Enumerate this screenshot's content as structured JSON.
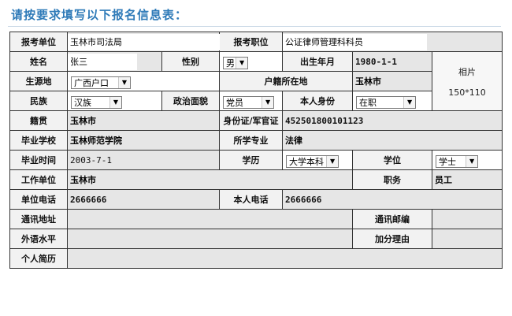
{
  "page": {
    "title": "请按要求填写以下报名信息表："
  },
  "form": {
    "bkdw": {
      "label": "报考单位",
      "value": "玉林市司法局"
    },
    "bkzw": {
      "label": "报考职位",
      "value": "公证律师管理科科员"
    },
    "name": {
      "label": "姓名",
      "value": "张三"
    },
    "gender": {
      "label": "性别",
      "value": "男"
    },
    "birth": {
      "label": "出生年月",
      "value": "1980-1-1"
    },
    "photo": {
      "line1": "相片",
      "line2": "150*110"
    },
    "origin": {
      "label": "生源地",
      "value": "广西户口"
    },
    "hukou": {
      "label": "户籍所在地",
      "value": "玉林市"
    },
    "ethnic": {
      "label": "民族",
      "value": "汉族"
    },
    "politic": {
      "label": "政治面貌",
      "value": "党员"
    },
    "identity": {
      "label": "本人身份",
      "value": "在职"
    },
    "native": {
      "label": "籍贯",
      "value": "玉林市"
    },
    "idcard": {
      "label": "身份证/军官证",
      "value": "452501800101123"
    },
    "school": {
      "label": "毕业学校",
      "value": "玉林师范学院"
    },
    "major": {
      "label": "所学专业",
      "value": "法律"
    },
    "gradtime": {
      "label": "毕业时间",
      "value": "2003-7-1"
    },
    "edu": {
      "label": "学历",
      "value": "大学本科"
    },
    "degree": {
      "label": "学位",
      "value": "学士"
    },
    "workunit": {
      "label": "工作单位",
      "value": "玉林市"
    },
    "job": {
      "label": "职务",
      "value": "员工"
    },
    "unitphone": {
      "label": "单位电话",
      "value": "2666666"
    },
    "myphone": {
      "label": "本人电话",
      "value": "2666666"
    },
    "address": {
      "label": "通讯地址",
      "value": ""
    },
    "postcode": {
      "label": "通讯邮编",
      "value": ""
    },
    "language": {
      "label": "外语水平",
      "value": ""
    },
    "bonus": {
      "label": "加分理由",
      "value": ""
    },
    "resume": {
      "label": "个人简历",
      "value": ""
    }
  }
}
